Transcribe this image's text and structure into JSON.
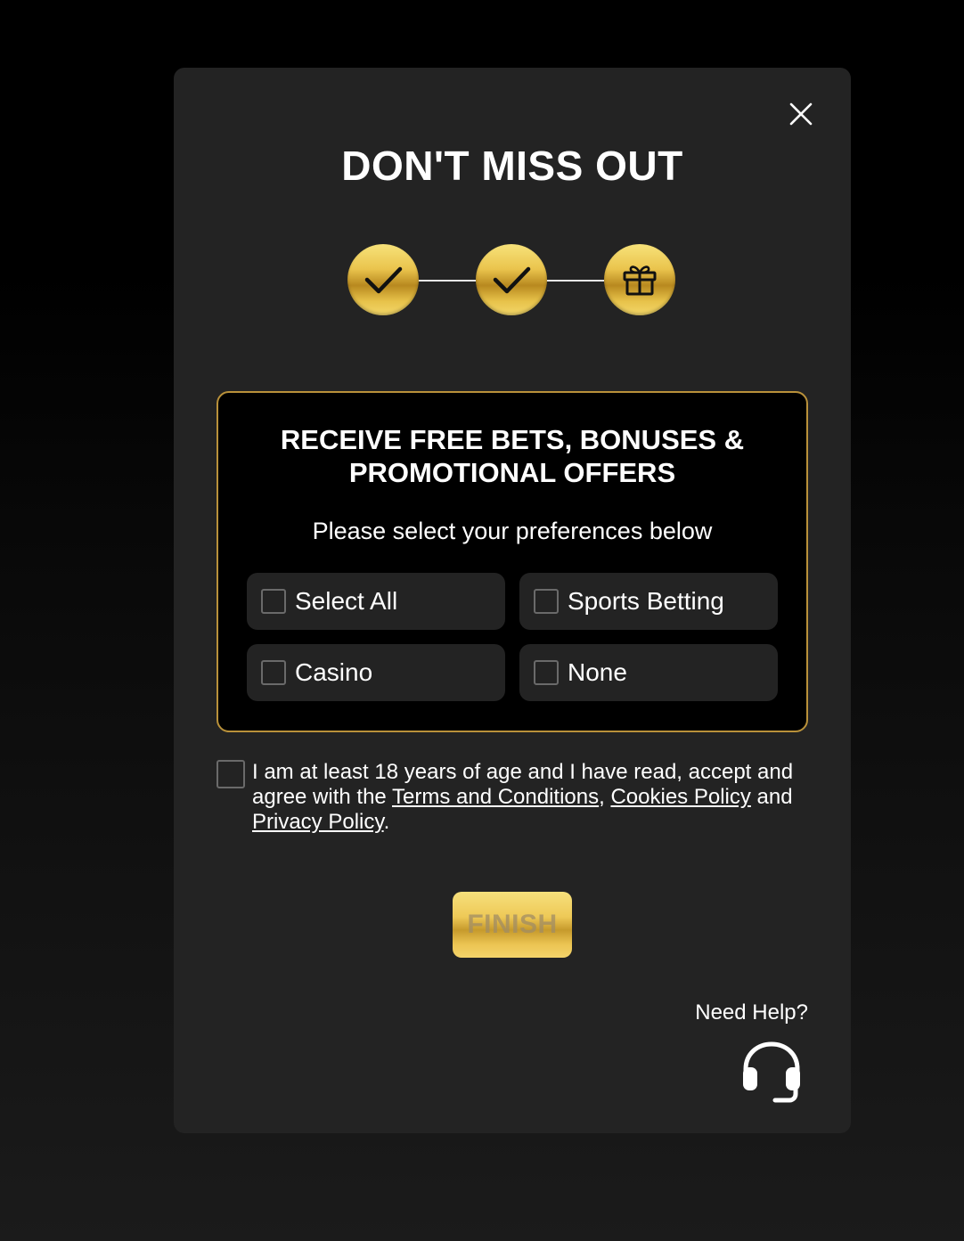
{
  "modal": {
    "title": "DON'T MISS OUT",
    "close_icon": "close-icon"
  },
  "stepper": {
    "steps": [
      {
        "state": "complete",
        "icon": "checkmark-icon"
      },
      {
        "state": "complete",
        "icon": "checkmark-icon"
      },
      {
        "state": "current",
        "icon": "gift-icon"
      }
    ]
  },
  "offers": {
    "title_line1": "RECEIVE FREE BETS, BONUSES &",
    "title_line2": "PROMOTIONAL OFFERS",
    "subtitle": "Please select your preferences below",
    "options": [
      {
        "label": "Select All",
        "checked": false
      },
      {
        "label": "Sports Betting",
        "checked": false
      },
      {
        "label": "Casino",
        "checked": false
      },
      {
        "label": "None",
        "checked": false
      }
    ]
  },
  "terms": {
    "text_before": "I am at least 18 years of age and I have read, accept and agree with the ",
    "terms_link": "Terms and Conditions",
    "separator": ",  ",
    "cookies_link": "Cookies Policy",
    "and_text": " and ",
    "privacy_link": "Privacy Policy",
    "end": ".",
    "checked": false
  },
  "finish_button": {
    "label": "FINISH",
    "enabled": false
  },
  "help": {
    "label": "Need Help?",
    "icon": "headset-icon"
  },
  "colors": {
    "background": "#000000",
    "modal": "#232323",
    "panel": "#000000",
    "panel_border": "#b9913a",
    "option_bg": "#232323",
    "gold": "#eac44d",
    "text": "#ffffff"
  }
}
